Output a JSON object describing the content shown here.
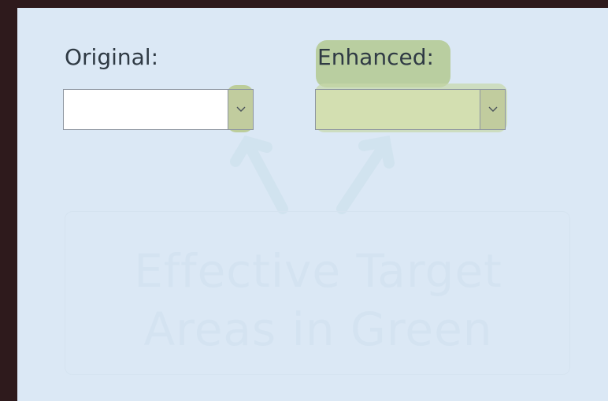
{
  "labels": {
    "original": "Original:",
    "enhanced": "Enhanced:"
  },
  "selects": {
    "original": {
      "value": "",
      "icon": "chevron-down-icon"
    },
    "enhanced": {
      "value": "",
      "icon": "chevron-down-icon"
    }
  },
  "watermark": {
    "text": "Effective Target\nAreas in Green"
  },
  "colors": {
    "window_border": "#2e1a1c",
    "panel_bg": "#dbe8f5",
    "highlight_green": "#b9cea0",
    "enhanced_select_bg": "#d3dfb1",
    "watermark_text": "#d4e3f1"
  }
}
